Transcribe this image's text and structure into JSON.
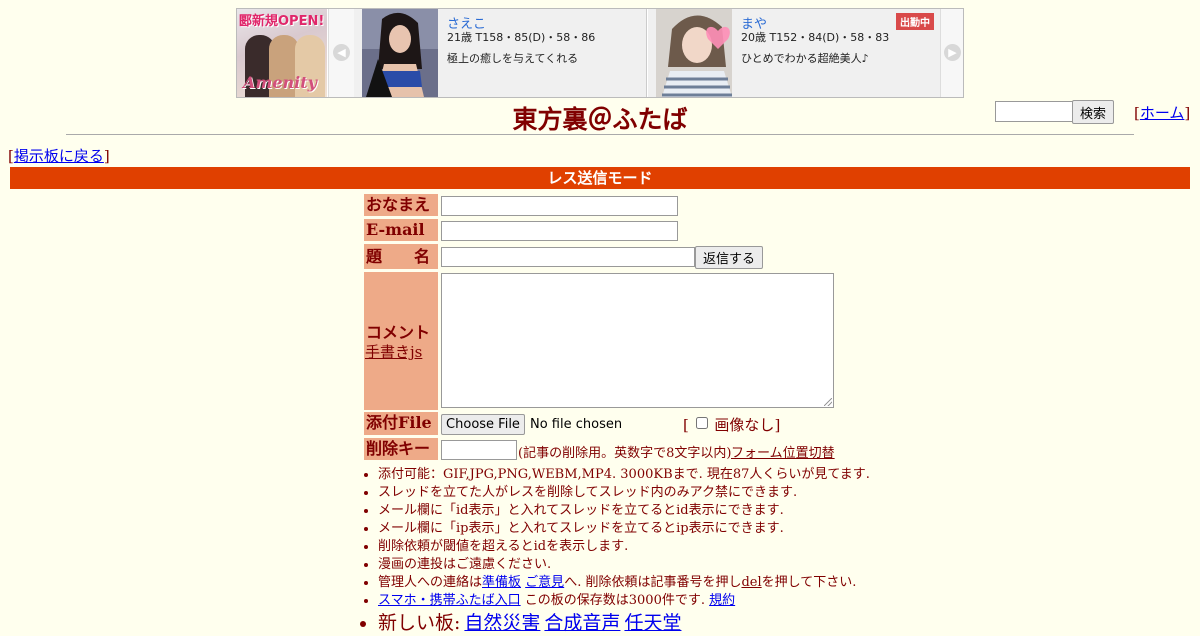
{
  "banner": {
    "promo_text": "郾新規OPEN!",
    "logo_text": "Amenity",
    "cards": [
      {
        "name": "さえこ",
        "spec": "21歳 T158・85(D)・58・86",
        "message": "極上の癒しを与えてくれる",
        "badge": ""
      },
      {
        "name": "まや",
        "spec": "20歳 T152・84(D)・58・83",
        "message": "ひとめでわかる超絶美人♪",
        "badge": "出勤中"
      }
    ],
    "prev_icon": "chevron-left-icon",
    "next_icon": "chevron-right-icon"
  },
  "header": {
    "title": "東方裏＠ふたば",
    "search_button": "検索",
    "home_open": "[",
    "home_label": "ホーム",
    "home_close": "]"
  },
  "nav": {
    "back_open": "[",
    "back_label": "掲示板に戻る",
    "back_close": "]"
  },
  "mode_bar": "レス送信モード",
  "form": {
    "name_label": "おなまえ",
    "email_label": "E-mail",
    "subject_label": "題　　名",
    "submit_label": "返信する",
    "comment_label": "コメント",
    "handwrite_link": "手書きjs",
    "file_label": "添付File",
    "file_button": "Choose File",
    "file_status": "No file chosen",
    "no_image_open": "[",
    "no_image_label": "画像なし",
    "no_image_close": "]",
    "delkey_label": "削除キー",
    "delkey_note": "(記事の削除用。英数字で8文字以内)",
    "form_position_link": "フォーム位置切替"
  },
  "notes": [
    {
      "text": "添付可能：GIF,JPG,PNG,WEBM,MP4. 3000KBまで. 現在87人くらいが見てます."
    },
    {
      "text": "スレッドを立てた人がレスを削除してスレッド内のみアク禁にできます."
    },
    {
      "text": "メール欄に「id表示」と入れてスレッドを立てるとid表示にできます."
    },
    {
      "text": "メール欄に「ip表示」と入れてスレッドを立てるとip表示にできます."
    },
    {
      "text": "削除依頼が閾値を超えるとidを表示します."
    },
    {
      "text": "漫画の連投はご遠慮ください."
    }
  ],
  "contact_note": {
    "prefix": "管理人への連絡は",
    "link1": "準備板",
    "link2": "ご意見",
    "mid": "へ. 削除依頼は記事番号を押し",
    "link3": "del",
    "suffix": "を押して下さい."
  },
  "mobile_note": {
    "link": "スマホ・携帯ふたば入口",
    "text": " この板の保存数は3000件です.",
    "rules_link": "規約"
  },
  "new_boards": {
    "label": "新しい板:",
    "links": [
      "自然災害",
      "合成音声",
      "任天堂"
    ]
  }
}
